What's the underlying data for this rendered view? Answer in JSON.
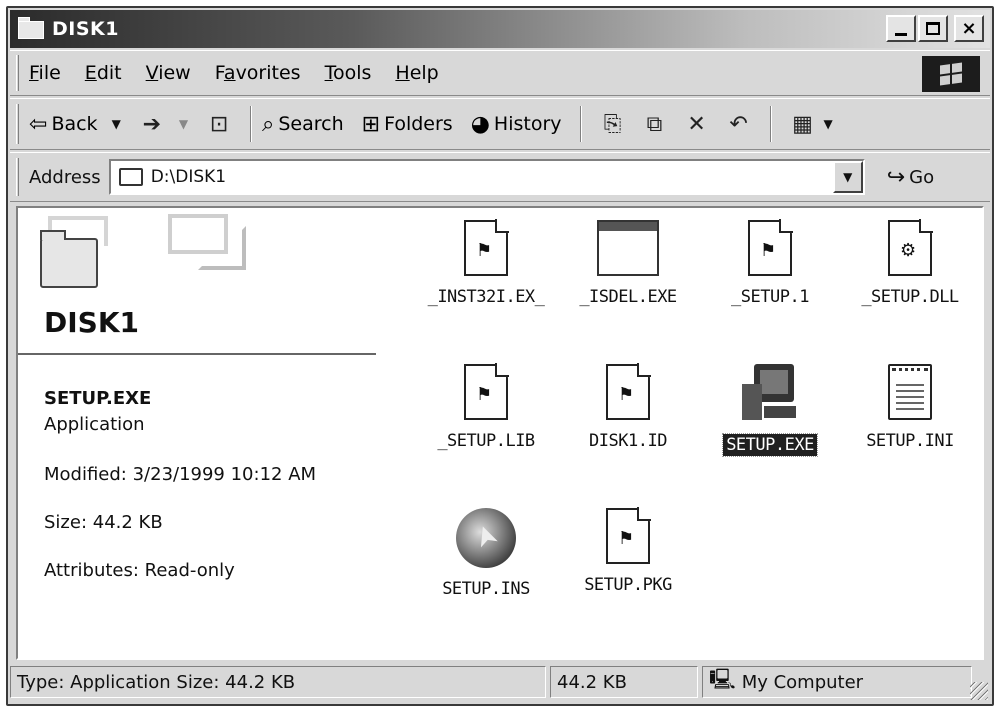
{
  "window": {
    "title": "DISK1"
  },
  "titlebar": {
    "min": "_",
    "close": "×"
  },
  "menu": [
    {
      "label_ul": "F",
      "label_rest": "ile"
    },
    {
      "label_ul": "E",
      "label_rest": "dit"
    },
    {
      "label_ul": "V",
      "label_rest": "iew"
    },
    {
      "label_pre": "F",
      "label_ul": "a",
      "label_rest": "vorites"
    },
    {
      "label_ul": "T",
      "label_rest": "ools"
    },
    {
      "label_ul": "H",
      "label_rest": "elp"
    }
  ],
  "toolbar": {
    "back": "Back",
    "search": "Search",
    "folders": "Folders",
    "history": "History"
  },
  "address": {
    "label": "Address",
    "value": "D:\\DISK1",
    "go": "Go"
  },
  "folder": {
    "title": "DISK1"
  },
  "details": {
    "name": "SETUP.EXE",
    "type": "Application",
    "modified": "Modified: 3/23/1999 10:12 AM",
    "size": "Size: 44.2 KB",
    "attributes": "Attributes: Read-only"
  },
  "files": [
    {
      "name": "_INST32I.EX_",
      "icon": "installer-doc-icon"
    },
    {
      "name": "_ISDEL.EXE",
      "icon": "window-icon"
    },
    {
      "name": "_SETUP.1",
      "icon": "installer-doc-icon"
    },
    {
      "name": "_SETUP.DLL",
      "icon": "gear-doc-icon"
    },
    {
      "name": "_SETUP.LIB",
      "icon": "installer-doc-icon"
    },
    {
      "name": "DISK1.ID",
      "icon": "installer-doc-icon"
    },
    {
      "name": "SETUP.EXE",
      "icon": "computer-setup-icon",
      "selected": true
    },
    {
      "name": "SETUP.INI",
      "icon": "ini-file-icon"
    },
    {
      "name": "SETUP.INS",
      "icon": "install-script-icon"
    },
    {
      "name": "SETUP.PKG",
      "icon": "installer-doc-icon"
    }
  ],
  "status": {
    "info": "Type: Application Size: 44.2 KB",
    "size": "44.2 KB",
    "zone": "My Computer"
  }
}
